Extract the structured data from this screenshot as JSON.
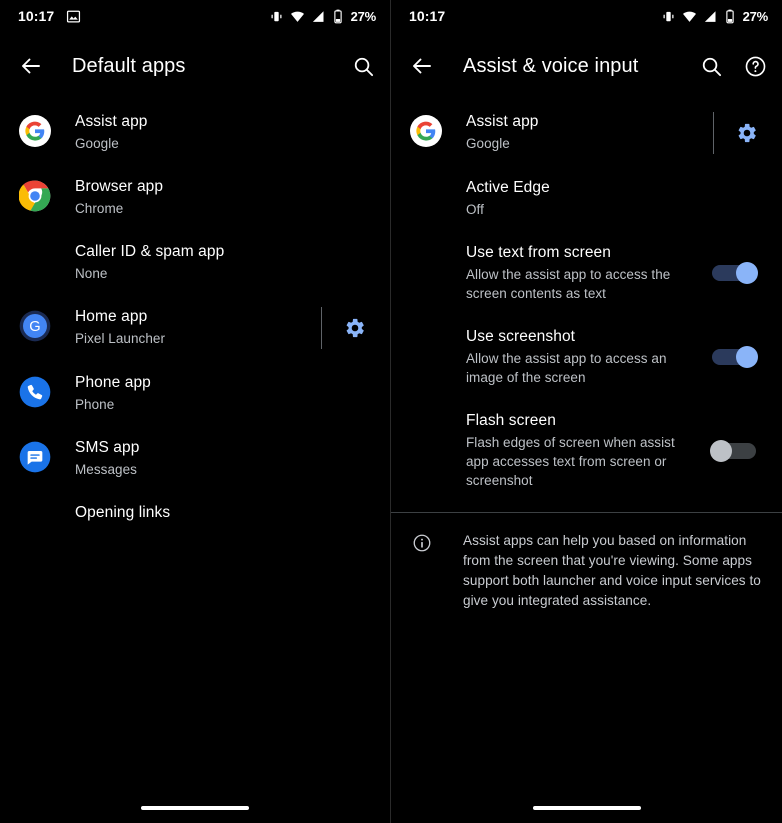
{
  "status_bar": {
    "time": "10:17",
    "battery": "27%",
    "notification_icons": [
      "image-icon"
    ],
    "system_icons": [
      "vibrate-icon",
      "wifi-icon",
      "signal-icon",
      "battery-icon"
    ]
  },
  "left_screen": {
    "title": "Default apps",
    "back_label": "Back",
    "actions": [
      {
        "name": "search-icon",
        "label": "Search"
      }
    ],
    "items": [
      {
        "icon": "google-icon",
        "title": "Assist app",
        "subtitle": "Google",
        "gear": false
      },
      {
        "icon": "chrome-icon",
        "title": "Browser app",
        "subtitle": "Chrome",
        "gear": false
      },
      {
        "icon": "none",
        "title": "Caller ID & spam app",
        "subtitle": "None",
        "gear": false
      },
      {
        "icon": "pixel-launcher-icon",
        "title": "Home app",
        "subtitle": "Pixel Launcher",
        "gear": true
      },
      {
        "icon": "phone-icon",
        "title": "Phone app",
        "subtitle": "Phone",
        "gear": false
      },
      {
        "icon": "messages-icon",
        "title": "SMS app",
        "subtitle": "Messages",
        "gear": false
      },
      {
        "icon": "none",
        "title": "Opening links",
        "subtitle": "",
        "gear": false
      }
    ]
  },
  "right_screen": {
    "title": "Assist & voice input",
    "back_label": "Back",
    "actions": [
      {
        "name": "search-icon",
        "label": "Search"
      },
      {
        "name": "help-icon",
        "label": "Help"
      }
    ],
    "items": [
      {
        "icon": "google-icon",
        "title": "Assist app",
        "subtitle": "Google",
        "gear": true,
        "toggle": null
      },
      {
        "icon": "none",
        "title": "Active Edge",
        "subtitle": "Off",
        "gear": false,
        "toggle": null
      },
      {
        "icon": "none",
        "title": "Use text from screen",
        "subtitle": "Allow the assist app to access the screen contents as text",
        "gear": false,
        "toggle": "on"
      },
      {
        "icon": "none",
        "title": "Use screenshot",
        "subtitle": "Allow the assist app to access an image of the screen",
        "gear": false,
        "toggle": "on"
      },
      {
        "icon": "none",
        "title": "Flash screen",
        "subtitle": "Flash edges of screen when assist app accesses text from screen or screenshot",
        "gear": false,
        "toggle": "off"
      }
    ],
    "footer_note": {
      "icon": "info-icon",
      "text": "Assist apps can help you based on information from the screen that you're viewing. Some apps support both launcher and voice input services to give you integrated assistance."
    }
  },
  "colors": {
    "background": "#000000",
    "primary_text": "#ffffff",
    "secondary_text": "#bdc1c6",
    "accent": "#8ab4f8",
    "divider": "#3c4043"
  }
}
